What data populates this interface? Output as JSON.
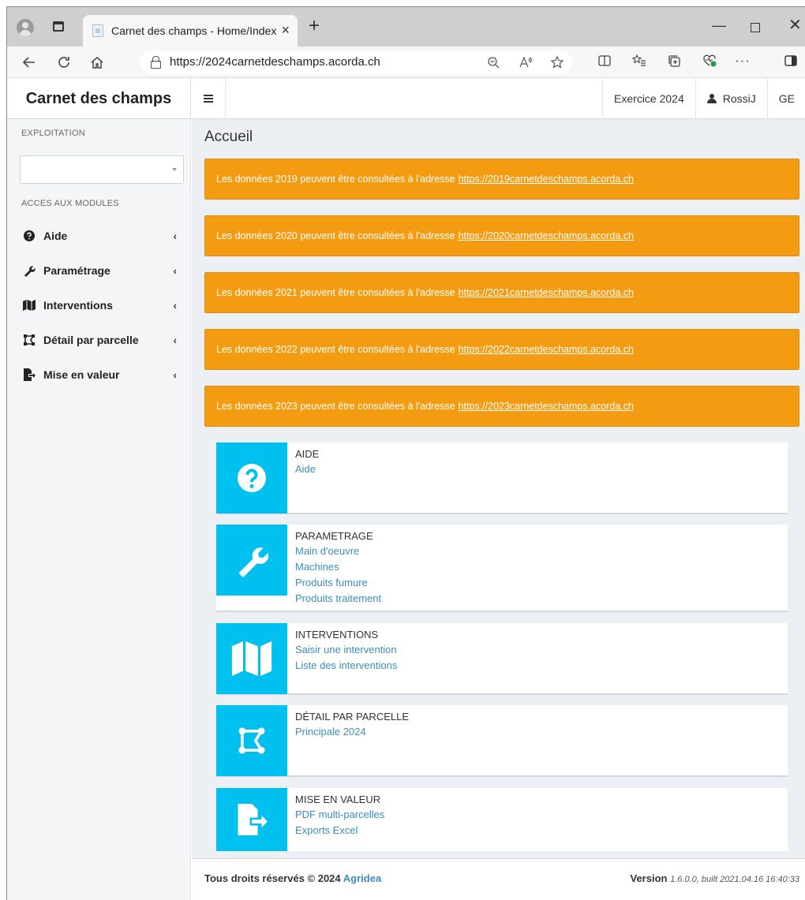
{
  "browser": {
    "tab_title": "Carnet des champs - Home/Index",
    "tab_close": "×",
    "new_tab": "+",
    "url": "https://2024carnetdeschamps.acorda.ch",
    "min": "—",
    "close": "✕",
    "more": "···"
  },
  "navbar": {
    "brand": "Carnet des champs",
    "exercice": "Exercice 2024",
    "user": "RossiJ",
    "canton": "GE"
  },
  "sidebar": {
    "exploitation_header": "EXPLOITATION",
    "select_value": "",
    "modules_header": "ACCES AUX MODULES",
    "items": [
      {
        "label": "Aide",
        "icon": "question-circle-icon"
      },
      {
        "label": "Paramétrage",
        "icon": "wrench-icon"
      },
      {
        "label": "Interventions",
        "icon": "map-icon"
      },
      {
        "label": "Détail par parcelle",
        "icon": "object-ungroup-icon"
      },
      {
        "label": "Mise en valeur",
        "icon": "sign-out-icon"
      }
    ],
    "chevron": "‹"
  },
  "main": {
    "title": "Accueil",
    "alerts": [
      {
        "text": "Les données 2019 peuvent être consultées à l'adresse",
        "link": "https://2019carnetdeschamps.acorda.ch"
      },
      {
        "text": "Les données 2020 peuvent être consultées à l'adresse",
        "link": "https://2020carnetdeschamps.acorda.ch"
      },
      {
        "text": "Les données 2021 peuvent être consultées à l'adresse",
        "link": "https://2021carnetdeschamps.acorda.ch"
      },
      {
        "text": "Les données 2022 peuvent être consultées à l'adresse",
        "link": "https://2022carnetdeschamps.acorda.ch"
      },
      {
        "text": "Les données 2023 peuvent être consultées à l'adresse",
        "link": "https://2023carnetdeschamps.acorda.ch"
      }
    ],
    "alert_color": "#f39c12",
    "module_color": "#00c0ef",
    "modules": [
      {
        "title": "AIDE",
        "icon": "question-circle-icon",
        "links": [
          "Aide"
        ]
      },
      {
        "title": "PARAMETRAGE",
        "icon": "wrench-icon",
        "links": [
          "Main d'oeuvre",
          "Machines",
          "Produits fumure",
          "Produits traitement"
        ]
      },
      {
        "title": "INTERVENTIONS",
        "icon": "map-icon",
        "links": [
          "Saisir une intervention",
          "Liste des interventions"
        ]
      },
      {
        "title": "DÉTAIL PAR PARCELLE",
        "icon": "object-ungroup-icon",
        "links": [
          "Principale 2024"
        ]
      },
      {
        "title": "MISE EN VALEUR",
        "icon": "sign-out-icon",
        "links": [
          "PDF multi-parcelles",
          "Exports Excel"
        ]
      }
    ]
  },
  "footer": {
    "rights": "Tous droits réservés © 2024",
    "company": "Agridea",
    "version_label": "Version",
    "version_value": "1.6.0.0, built 2021.04.16 16:40:33"
  }
}
